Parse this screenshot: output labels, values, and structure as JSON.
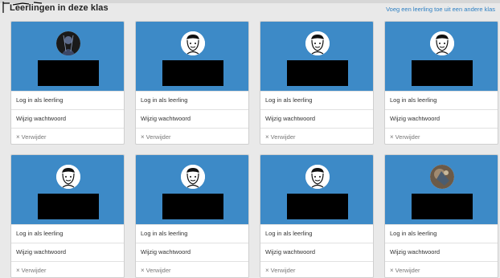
{
  "page": {
    "title": "Leerlingen in deze klas",
    "add_link": "Voeg een leerling toe uit een andere klas"
  },
  "colors": {
    "card_header": "#3d8ac7",
    "link": "#2d7fc2",
    "name_redaction": "#000000"
  },
  "students": [
    {
      "avatar": "dark-portrait-photo",
      "login": "Log in als leerling",
      "change_password": "Wijzig wachtwoord",
      "remove": "Verwijder"
    },
    {
      "avatar": "default-student-icon",
      "login": "Log in als leerling",
      "change_password": "Wijzig wachtwoord",
      "remove": "Verwijder"
    },
    {
      "avatar": "default-student-icon",
      "login": "Log in als leerling",
      "change_password": "Wijzig wachtwoord",
      "remove": "Verwijder"
    },
    {
      "avatar": "default-student-icon",
      "login": "Log in als leerling",
      "change_password": "Wijzig wachtwoord",
      "remove": "Verwijder"
    },
    {
      "avatar": "default-student-icon",
      "login": "Log in als leerling",
      "change_password": "Wijzig wachtwoord",
      "remove": "Verwijder"
    },
    {
      "avatar": "default-student-icon",
      "login": "Log in als leerling",
      "change_password": "Wijzig wachtwoord",
      "remove": "Verwijder"
    },
    {
      "avatar": "default-student-icon",
      "login": "Log in als leerling",
      "change_password": "Wijzig wachtwoord",
      "remove": "Verwijder"
    },
    {
      "avatar": "photo-avatar",
      "login": "Log in als leerling",
      "change_password": "Wijzig wachtwoord",
      "remove": "Verwijder"
    }
  ]
}
